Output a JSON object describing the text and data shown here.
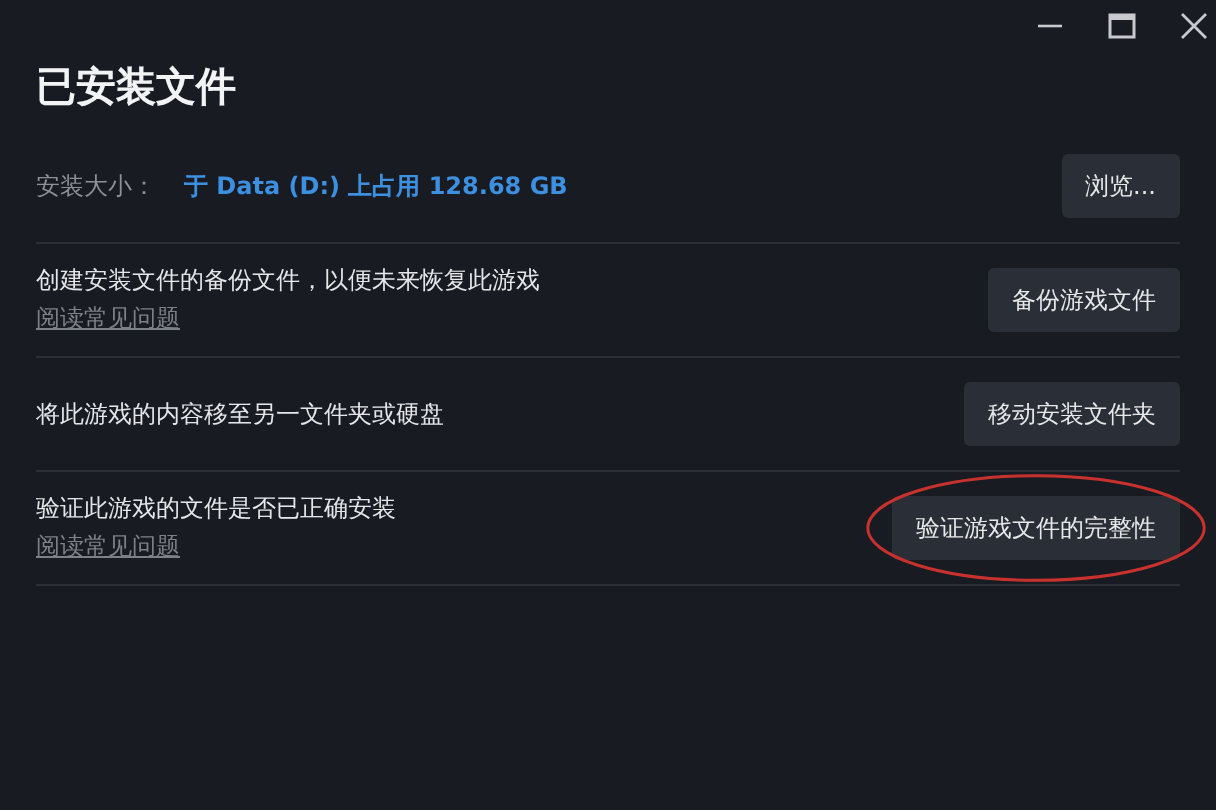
{
  "window": {
    "title": "已安装文件"
  },
  "install_size": {
    "label": "安装大小：",
    "value": "于 Data (D:) 上占用 128.68 GB",
    "button": "浏览..."
  },
  "actions": [
    {
      "description": "创建安装文件的备份文件，以便未来恢复此游戏",
      "link": "阅读常见问题",
      "button": "备份游戏文件",
      "highlighted": false
    },
    {
      "description": "将此游戏的内容移至另一文件夹或硬盘",
      "button": "移动安装文件夹",
      "highlighted": false
    },
    {
      "description": "验证此游戏的文件是否已正确安装",
      "link": "阅读常见问题",
      "button": "验证游戏文件的完整性",
      "highlighted": true
    }
  ]
}
